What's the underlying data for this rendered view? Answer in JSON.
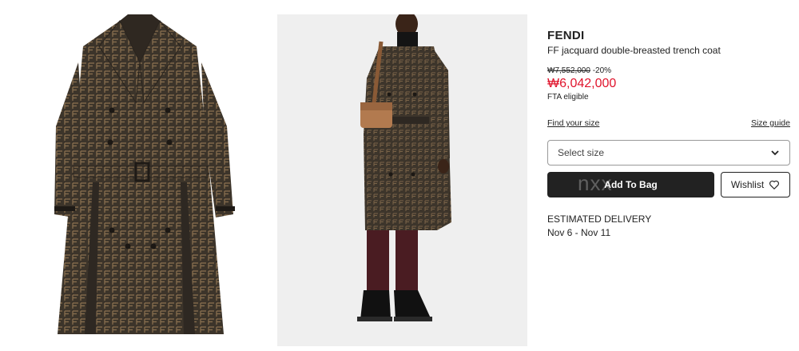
{
  "gallery": {
    "images": [
      {
        "alt": "FF jacquard double-breasted trench coat front view"
      },
      {
        "alt": "Model wearing FF jacquard double-breasted trench coat"
      }
    ]
  },
  "product": {
    "brand": "FENDI",
    "name": "FF jacquard double-breasted trench coat",
    "original_price": "₩7,552,000",
    "discount": "-20%",
    "sale_price": "₩6,042,000",
    "fta_label": "FTA eligible"
  },
  "size": {
    "find_your_size": "Find your size",
    "size_guide": "Size guide",
    "select_placeholder": "Select size"
  },
  "actions": {
    "add_to_bag": "Add To Bag",
    "wishlist": "Wishlist",
    "watermark": "nxx"
  },
  "delivery": {
    "label": "ESTIMATED DELIVERY",
    "dates": "Nov 6 - Nov 11"
  },
  "colors": {
    "sale": "#e0142c",
    "button_dark": "#222222",
    "coat_brown": "#3f372c"
  },
  "icons": {
    "select": "chevron-down-icon",
    "wishlist": "heart-icon"
  }
}
